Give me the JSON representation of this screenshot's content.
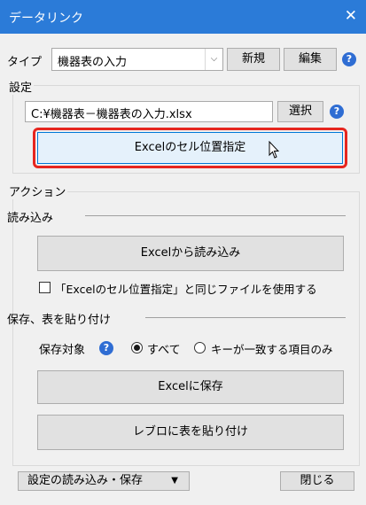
{
  "window": {
    "title": "データリンク",
    "close_glyph": "✕"
  },
  "type_row": {
    "label": "タイプ",
    "selected": "機器表の入力",
    "new_label": "新規",
    "edit_label": "編集"
  },
  "settings": {
    "group_label": "設定",
    "file_path": "C:¥機器表－機器表の入力.xlsx",
    "select_label": "選択",
    "cell_pos_label": "Excelのセル位置指定"
  },
  "action": {
    "group_label": "アクション",
    "read": {
      "heading": "読み込み",
      "read_button": "Excelから読み込み",
      "same_file_checkbox": "「Excelのセル位置指定」と同じファイルを使用する",
      "same_file_checked": false
    },
    "save": {
      "heading": "保存、表を貼り付け",
      "target_label": "保存対象",
      "option_all": "すべて",
      "option_key": "キーが一致する項目のみ",
      "selected": "all",
      "save_button": "Excelに保存",
      "paste_button": "レブロに表を貼り付け"
    }
  },
  "footer": {
    "load_save_label": "設定の読み込み・保存",
    "close_label": "閉じる"
  },
  "icons": {
    "help": "help-icon",
    "dropdown": "chevron-down-icon",
    "cursor": "mouse-pointer-icon"
  },
  "colors": {
    "titlebar": "#2b7bd8",
    "highlight": "#e6261f",
    "selected_button_border": "#0078d7"
  }
}
